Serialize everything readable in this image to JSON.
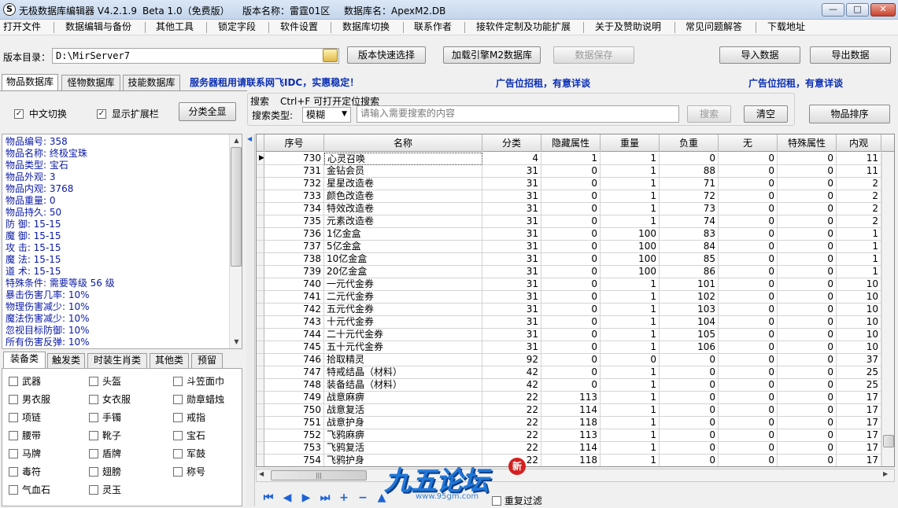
{
  "titlebar": {
    "segments": [
      "无极数据库编辑器 V4.2.1.9",
      "Beta 1.0（免费版）",
      "版本名称：雷霆01区",
      "数据库名：ApexM2.DB"
    ],
    "min": "—",
    "max": "□",
    "close": "✕"
  },
  "menu": [
    "打开文件",
    "数据编辑与备份",
    "其他工具",
    "锁定字段",
    "软件设置",
    "数据库切换",
    "联系作者",
    "接软件定制及功能扩展",
    "关于及赞助说明",
    "常见问题解答",
    "下载地址"
  ],
  "toolbar": {
    "dir_label": "版本目录：",
    "dir_value": "D:\\MirServer7",
    "quick_select": "版本快速选择",
    "load_engine": "加载引擎M2数据库",
    "save_data": "数据保存",
    "import": "导入数据",
    "export": "导出数据"
  },
  "db_tabs": [
    "物品数据库",
    "怪物数据库",
    "技能数据库"
  ],
  "ads": [
    "服务器租用请联系网飞IDC，实惠稳定！",
    "广告位招租，有意详谈",
    "广告位招租，有意详谈"
  ],
  "options": {
    "chinese_switch": "中文切换",
    "show_ext": "显示扩展栏",
    "show_all": "分类全显",
    "checked_glyph": "✓"
  },
  "search": {
    "title": "搜索",
    "hint": "Ctrl+F 可打开定位搜索",
    "type_label": "搜索类型:",
    "type_value": "模糊",
    "placeholder": "请输入需要搜索的内容",
    "search_btn": "搜索",
    "clear_btn": "清空",
    "sort_btn": "物品排序"
  },
  "info_lines": [
    "物品编号: 358",
    "物品名称: 终极宝珠",
    "物品类型: 宝石",
    "物品外观: 3",
    "物品内观: 3768",
    "物品重量: 0",
    "物品持久: 50",
    "防    御: 15-15",
    "魔    御: 15-15",
    "攻    击: 15-15",
    "魔    法: 15-15",
    "道    术: 15-15",
    "特殊条件: 需要等级 56 级",
    "暴击伤害几率: 10%",
    "物理伤害减少: 10%",
    "魔法伤害减少: 10%",
    "忽视目标防御: 10%",
    "所有伤害反弹: 10%"
  ],
  "cat_tabs": [
    "装备类",
    "触发类",
    "时装生肖类",
    "其他类",
    "预留"
  ],
  "categories": [
    [
      "武器",
      "头盔",
      "斗笠面巾"
    ],
    [
      "男衣服",
      "女衣服",
      "勋章蜡烛"
    ],
    [
      "项链",
      "手镯",
      "戒指"
    ],
    [
      "腰带",
      "靴子",
      "宝石"
    ],
    [
      "马牌",
      "盾牌",
      "军鼓"
    ],
    [
      "毒符",
      "翅膀",
      "称号"
    ],
    [
      "气血石",
      "灵玉"
    ]
  ],
  "grid": {
    "columns": [
      "序号",
      "名称",
      "分类",
      "隐藏属性",
      "重量",
      "负重",
      "无",
      "特殊属性",
      "内观"
    ],
    "row_marker": "▶",
    "rows": [
      [
        "730",
        "心灵召唤",
        "4",
        "1",
        "1",
        "0",
        "0",
        "0",
        "11"
      ],
      [
        "731",
        "金钻会员",
        "31",
        "0",
        "1",
        "88",
        "0",
        "0",
        "11"
      ],
      [
        "732",
        "星星改造卷",
        "31",
        "0",
        "1",
        "71",
        "0",
        "0",
        "2"
      ],
      [
        "733",
        "颜色改造卷",
        "31",
        "0",
        "1",
        "72",
        "0",
        "0",
        "2"
      ],
      [
        "734",
        "特效改造卷",
        "31",
        "0",
        "1",
        "73",
        "0",
        "0",
        "2"
      ],
      [
        "735",
        "元素改造卷",
        "31",
        "0",
        "1",
        "74",
        "0",
        "0",
        "2"
      ],
      [
        "736",
        "1亿金盒",
        "31",
        "0",
        "100",
        "83",
        "0",
        "0",
        "1"
      ],
      [
        "737",
        "5亿金盒",
        "31",
        "0",
        "100",
        "84",
        "0",
        "0",
        "1"
      ],
      [
        "738",
        "10亿金盒",
        "31",
        "0",
        "100",
        "85",
        "0",
        "0",
        "1"
      ],
      [
        "739",
        "20亿金盒",
        "31",
        "0",
        "100",
        "86",
        "0",
        "0",
        "1"
      ],
      [
        "740",
        "一元代金券",
        "31",
        "0",
        "1",
        "101",
        "0",
        "0",
        "10"
      ],
      [
        "741",
        "二元代金券",
        "31",
        "0",
        "1",
        "102",
        "0",
        "0",
        "10"
      ],
      [
        "742",
        "五元代金券",
        "31",
        "0",
        "1",
        "103",
        "0",
        "0",
        "10"
      ],
      [
        "743",
        "十元代金券",
        "31",
        "0",
        "1",
        "104",
        "0",
        "0",
        "10"
      ],
      [
        "744",
        "二十元代金券",
        "31",
        "0",
        "1",
        "105",
        "0",
        "0",
        "10"
      ],
      [
        "745",
        "五十元代金券",
        "31",
        "0",
        "1",
        "106",
        "0",
        "0",
        "10"
      ],
      [
        "746",
        "拾取精灵",
        "92",
        "0",
        "0",
        "0",
        "0",
        "0",
        "37"
      ],
      [
        "747",
        "特戒结晶（材料）",
        "42",
        "0",
        "1",
        "0",
        "0",
        "0",
        "25"
      ],
      [
        "748",
        "装备结晶（材料）",
        "42",
        "0",
        "1",
        "0",
        "0",
        "0",
        "25"
      ],
      [
        "749",
        "战意麻痹",
        "22",
        "113",
        "1",
        "0",
        "0",
        "0",
        "17"
      ],
      [
        "750",
        "战意复活",
        "22",
        "114",
        "1",
        "0",
        "0",
        "0",
        "17"
      ],
      [
        "751",
        "战意护身",
        "22",
        "118",
        "1",
        "0",
        "0",
        "0",
        "17"
      ],
      [
        "752",
        "飞鸦麻痹",
        "22",
        "113",
        "1",
        "0",
        "0",
        "0",
        "17"
      ],
      [
        "753",
        "飞鸦复活",
        "22",
        "114",
        "1",
        "0",
        "0",
        "0",
        "17"
      ],
      [
        "754",
        "飞鸦护身",
        "22",
        "118",
        "1",
        "0",
        "0",
        "0",
        "17"
      ]
    ]
  },
  "bottom": {
    "nav_icons": [
      "first-icon",
      "prev-icon",
      "next-icon",
      "last-icon",
      "add-icon",
      "remove-icon",
      "up-icon"
    ],
    "nav_glyphs": [
      "⏮",
      "◀",
      "▶",
      "⏭",
      "+",
      "−",
      "▲"
    ],
    "dup_filter": "重复过滤",
    "scroll_grip": "|||"
  },
  "watermark": {
    "text": "九五论坛",
    "badge": "新",
    "url": "www.95gm.com"
  },
  "colors": {
    "info_text": "#0a1aa8",
    "ad_text": "#0b2fb4",
    "nav_icon": "#1e63d6",
    "watermark": "#1f76d8"
  }
}
